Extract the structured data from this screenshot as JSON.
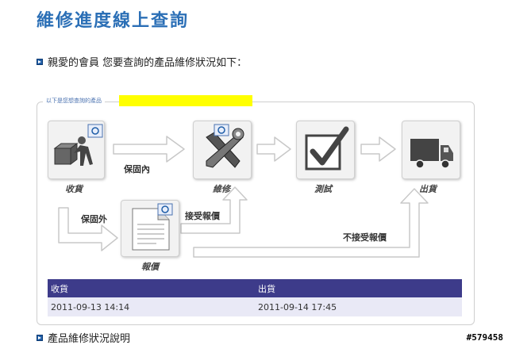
{
  "page": {
    "title": "維修進度線上查詢",
    "greeting": "親愛的會員 您要查詢的產品維修狀況如下：",
    "panel_legend": "以下是您想查詢的產品",
    "footer_link": "產品維修狀況說明",
    "watermark": "#579458"
  },
  "flow": {
    "steps": {
      "receive": "收貨",
      "repair": "維修",
      "test": "測試",
      "ship": "出貨",
      "quote": "報價"
    },
    "arrows": {
      "in_warranty": "保固內",
      "out_warranty": "保固外",
      "accept_quote": "接受報價",
      "reject_quote": "不接受報價"
    }
  },
  "table": {
    "headers": [
      "收貨",
      "出貨"
    ],
    "values": [
      "2011-09-13 14:14",
      "2011-09-14 17:45"
    ]
  },
  "colors": {
    "title": "#2b6fb6",
    "table_header": "#3d3b8a",
    "table_row": "#e9e9f6",
    "highlight": "#ffff00"
  }
}
